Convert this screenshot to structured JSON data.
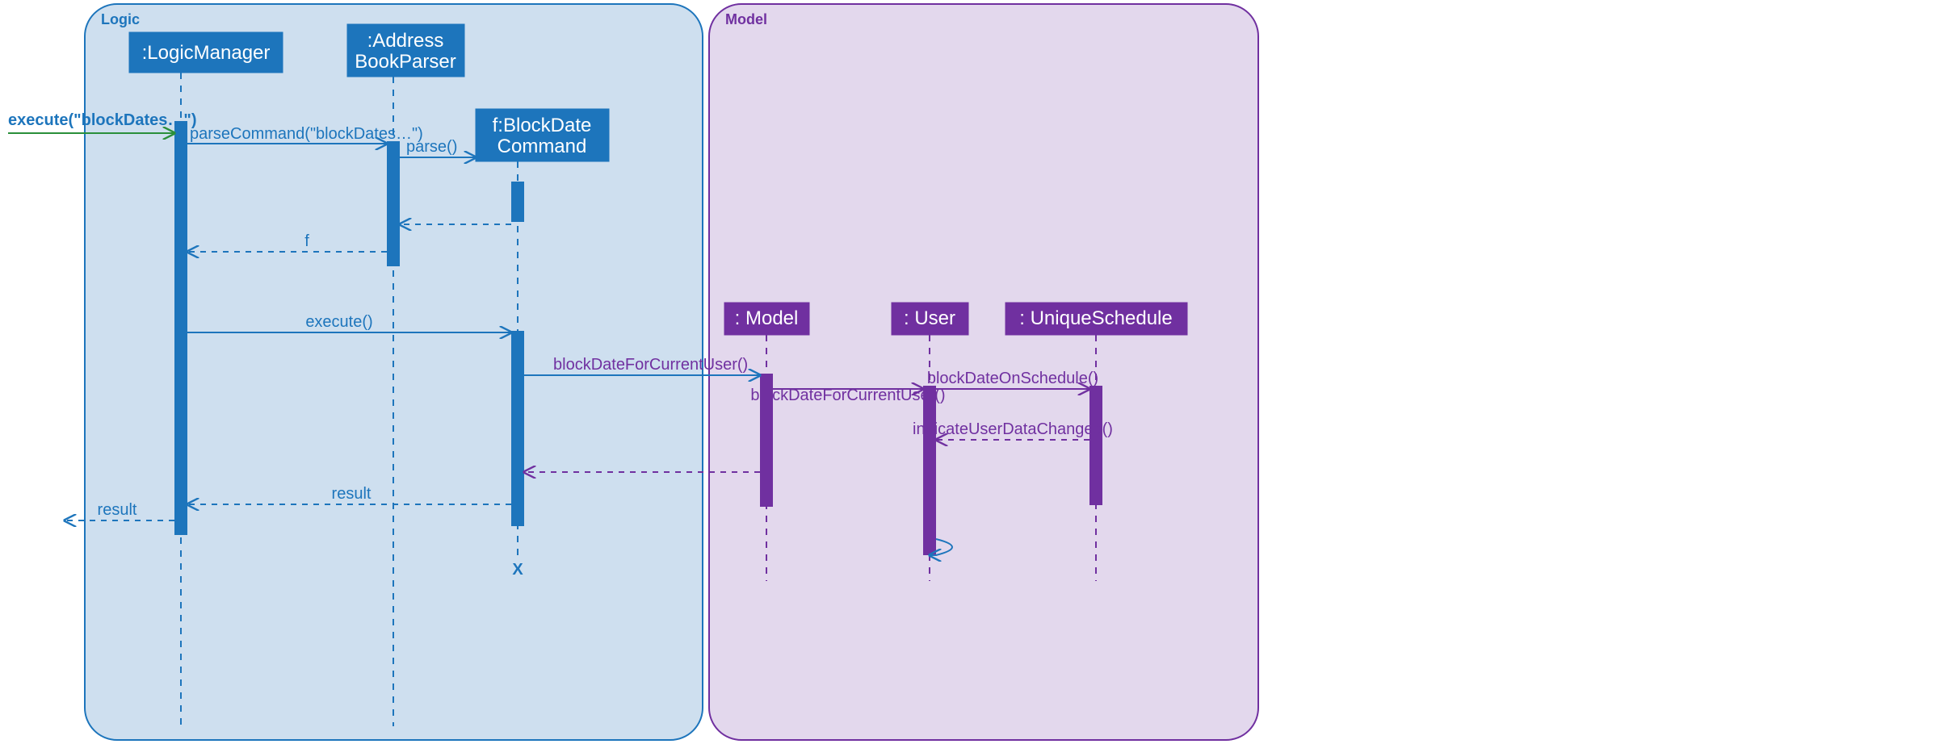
{
  "frames": {
    "logic": {
      "label": "Logic",
      "color": "#1d75bc"
    },
    "model": {
      "label": "Model",
      "color": "#7030a0"
    }
  },
  "lifelines": {
    "logicManager": {
      "label": ":LogicManager"
    },
    "addressParser": {
      "label_line1": ":Address",
      "label_line2": "BookParser"
    },
    "blockDateCmd": {
      "label_line1": "f:BlockDate",
      "label_line2": "Command"
    },
    "model": {
      "label": ": Model"
    },
    "user": {
      "label": ": User"
    },
    "uniqueSchedule": {
      "label": ": UniqueSchedule"
    }
  },
  "messages": {
    "execute_in": "execute(\"blockDates…\")",
    "parseCommand": "parseCommand(\"blockDates…\")",
    "parse": "parse()",
    "return_f": "f",
    "execute_cmd": "execute()",
    "blockDateForCurrentUser1": "blockDateForCurrentUser()",
    "blockDateForCurrentUser2": "blockDateForCurrentUser()",
    "blockDateOnSchedule": "blockDateOnSchedule()",
    "indicateUserDataChanged": "indicateUserDataChanged()",
    "result1": "result",
    "result2": "result",
    "destroy": "X"
  }
}
